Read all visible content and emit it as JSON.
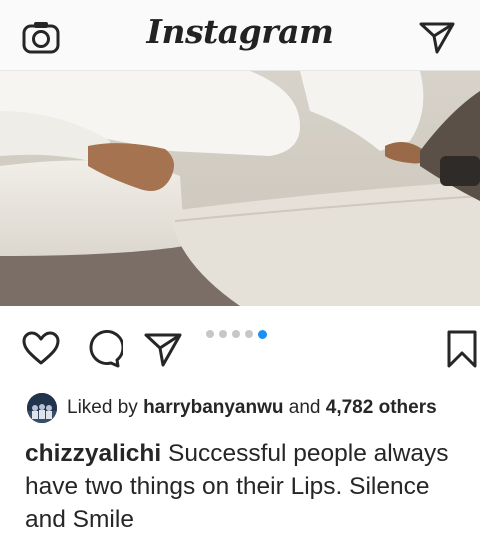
{
  "header": {
    "title": "Instagram",
    "camera_icon": "camera-icon",
    "direct_icon": "paper-plane-icon"
  },
  "post": {
    "image_subject": "person in white clothes reclining on a white sofa",
    "carousel": {
      "total": 5,
      "active_index": 4,
      "active_color": "#1a8ff5"
    },
    "actions": {
      "like_icon": "heart-icon",
      "comment_icon": "comment-icon",
      "share_icon": "paper-plane-icon",
      "save_icon": "bookmark-icon"
    },
    "likes": {
      "prefix": "Liked by",
      "user": "harrybanyanwu",
      "middle": "and",
      "others": "4,782 others"
    },
    "caption": {
      "username": "chizzyalichi",
      "text": "Successful people always have two things on their Lips. Silence and Smile"
    }
  }
}
